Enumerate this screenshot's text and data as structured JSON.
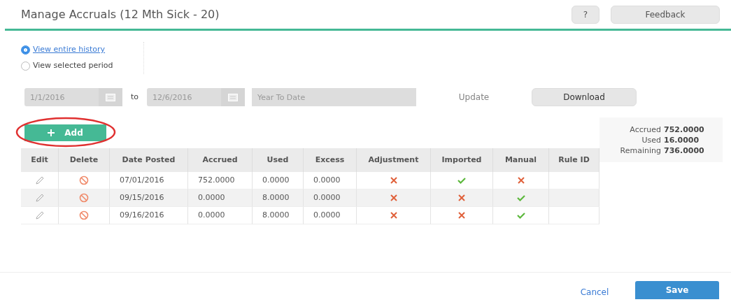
{
  "window": {
    "title": "Manage Accruals (12 Mth Sick - 20)"
  },
  "header_buttons": [
    {
      "label": "?",
      "kind": "help"
    },
    {
      "label": "Feedback",
      "kind": "feedback"
    }
  ],
  "view_options": [
    {
      "label": "View entire history",
      "selected": true
    },
    {
      "label": "View selected period",
      "selected": false
    }
  ],
  "filter": {
    "start_date": "1/1/2016",
    "to_label": "to",
    "end_date": "12/6/2016",
    "period": "Year To Date",
    "update_button": {
      "label": "Update",
      "disabled": true
    },
    "download_button": "Download"
  },
  "add_button": {
    "label": "Add",
    "circled": true
  },
  "table": {
    "columns": [
      "Edit",
      "Delete",
      "Date Posted",
      "Accrued",
      "Used",
      "Excess",
      "Adjustment",
      "Imported",
      "Manual",
      "Rule ID"
    ],
    "rows": [
      {
        "date_posted": "07/01/2016",
        "accrued": "752.0000",
        "used": "0.0000",
        "excess": "0.0000",
        "adjustment": false,
        "imported": true,
        "manual": false
      },
      {
        "date_posted": "09/15/2016",
        "accrued": "0.0000",
        "used": "8.0000",
        "excess": "0.0000",
        "adjustment": false,
        "imported": false,
        "manual": true
      },
      {
        "date_posted": "09/16/2016",
        "accrued": "0.0000",
        "used": "8.0000",
        "excess": "0.0000",
        "adjustment": false,
        "imported": false,
        "manual": true
      }
    ]
  },
  "summary": [
    {
      "label": "Accrued",
      "value": "752.0000"
    },
    {
      "label": "Used",
      "value": "16.0000"
    },
    {
      "label": "Remaining",
      "value": "736.0000"
    }
  ],
  "footer": {
    "cancel": "Cancel",
    "save": "Save"
  }
}
